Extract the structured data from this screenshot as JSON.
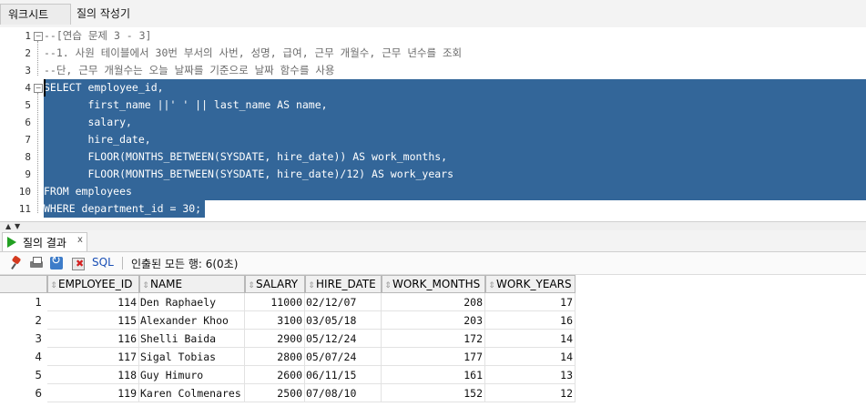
{
  "top_tabs": [
    {
      "label": "워크시트"
    },
    {
      "label": "질의 작성기"
    }
  ],
  "editor": {
    "line_numbers": [
      "1",
      "2",
      "3",
      "4",
      "5",
      "6",
      "7",
      "8",
      "9",
      "10",
      "11"
    ],
    "lines": [
      "--[연습 문제 3 - 3]",
      "--1. 사원 테이블에서 30번 부서의 사번, 성명, 급여, 근무 개월수, 근무 년수를 조회",
      "--단, 근무 개월수는 오늘 날짜를 기준으로 날짜 함수를 사용",
      "SELECT employee_id,",
      "       first_name ||' ' || last_name AS name,",
      "       salary,",
      "       hire_date,",
      "       FLOOR(MONTHS_BETWEEN(SYSDATE, hire_date)) AS work_months,",
      "       FLOOR(MONTHS_BETWEEN(SYSDATE, hire_date)/12) AS work_years",
      "FROM employees",
      "WHERE department_id = 30;"
    ]
  },
  "result_tab": {
    "label": "질의 결과",
    "close": "x"
  },
  "toolbar": {
    "sql_label": "SQL",
    "separator": "|",
    "status": "인출된 모든 행: 6(0초)"
  },
  "grid": {
    "columns": [
      "EMPLOYEE_ID",
      "NAME",
      "SALARY",
      "HIRE_DATE",
      "WORK_MONTHS",
      "WORK_YEARS"
    ],
    "rows": [
      {
        "row_no": "1",
        "cells": [
          "114",
          "Den Raphaely",
          "11000",
          "02/12/07",
          "208",
          "17"
        ]
      },
      {
        "row_no": "2",
        "cells": [
          "115",
          "Alexander Khoo",
          "3100",
          "03/05/18",
          "203",
          "16"
        ]
      },
      {
        "row_no": "3",
        "cells": [
          "116",
          "Shelli Baida",
          "2900",
          "05/12/24",
          "172",
          "14"
        ]
      },
      {
        "row_no": "4",
        "cells": [
          "117",
          "Sigal Tobias",
          "2800",
          "05/07/24",
          "177",
          "14"
        ]
      },
      {
        "row_no": "5",
        "cells": [
          "118",
          "Guy Himuro",
          "2600",
          "06/11/15",
          "161",
          "13"
        ]
      },
      {
        "row_no": "6",
        "cells": [
          "119",
          "Karen Colmenares",
          "2500",
          "07/08/10",
          "152",
          "12"
        ]
      }
    ]
  },
  "colors": {
    "selection": "#336699",
    "run_icon": "#22a022",
    "sql_link": "#1a4fb5"
  }
}
